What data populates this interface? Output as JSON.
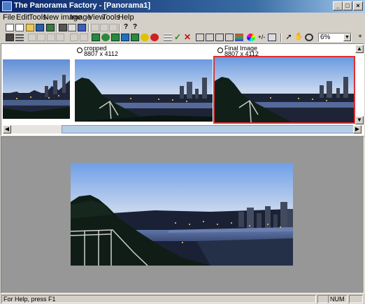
{
  "window": {
    "title": "The Panorama Factory - [Panorama1]"
  },
  "menu": [
    "File",
    "Edit",
    "Tools",
    "New image",
    "Image",
    "View",
    "Tools",
    "Help"
  ],
  "toolbar1": {
    "icons": [
      "new-icon",
      "open-icon",
      "save-icon",
      "save-all-icon",
      "print-icon",
      "print-preview-icon",
      "book-icon",
      "cut-icon",
      "copy-icon",
      "paste-icon",
      "help-icon",
      "context-help-icon"
    ]
  },
  "toolbar2": {
    "icons": [
      "camera-icon",
      "grid-icon",
      "rotate-left-icon",
      "rotate-right-icon",
      "undo-icon",
      "redo-icon",
      "stitch-icon",
      "settings-icon",
      "panorama-icon",
      "lens-icon",
      "crop-icon",
      "image-icon",
      "blend-icon",
      "record-icon",
      "checklist-icon",
      "accept-icon",
      "reject-icon",
      "align-icon",
      "fine-tune-icon",
      "levels-icon",
      "sharpen-icon",
      "palette-icon",
      "color-wheel-icon",
      "plus-minus-icon",
      "histogram-icon",
      "pointer-icon",
      "hand-icon",
      "zoom-icon"
    ],
    "zoom_value": "6%"
  },
  "thumbnails": [
    {
      "label": "",
      "size": ""
    },
    {
      "label": "cropped",
      "size": "8807 x 4112"
    },
    {
      "label": "Final Image",
      "size": "8807 x 4112"
    }
  ],
  "status": {
    "help_text": "For Help, press F1",
    "num": "NUM"
  },
  "colors": {
    "title_start": "#0a246a",
    "title_end": "#a6caf0",
    "selection_border": "#e03030",
    "workspace": "#979797"
  }
}
